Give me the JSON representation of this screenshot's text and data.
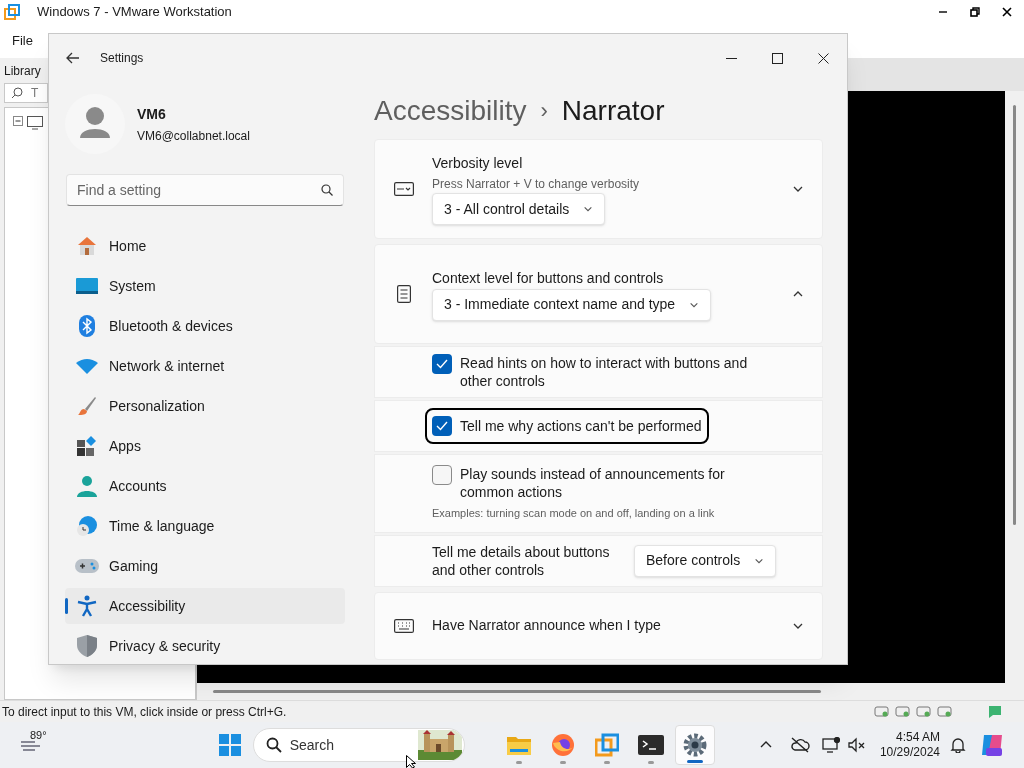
{
  "vmware": {
    "title": "Windows 7 - VMware Workstation",
    "menu": [
      "File"
    ],
    "library": {
      "label": "Library",
      "search_text": "T"
    },
    "status_text": "To direct input to this VM, click inside or press Ctrl+G."
  },
  "settings": {
    "title": "Settings",
    "user": {
      "name": "VM6",
      "email": "VM6@collabnet.local"
    },
    "search": {
      "placeholder": "Find a setting"
    },
    "nav": [
      {
        "label": "Home",
        "selected": false
      },
      {
        "label": "System",
        "selected": false
      },
      {
        "label": "Bluetooth & devices",
        "selected": false
      },
      {
        "label": "Network & internet",
        "selected": false
      },
      {
        "label": "Personalization",
        "selected": false
      },
      {
        "label": "Apps",
        "selected": false
      },
      {
        "label": "Accounts",
        "selected": false
      },
      {
        "label": "Time & language",
        "selected": false
      },
      {
        "label": "Gaming",
        "selected": false
      },
      {
        "label": "Accessibility",
        "selected": true
      },
      {
        "label": "Privacy & security",
        "selected": false
      }
    ],
    "breadcrumb": {
      "parent": "Accessibility",
      "separator": "›",
      "current": "Narrator"
    },
    "cards": [
      {
        "kind": "expander",
        "title": "Verbosity level",
        "subtitle": "Press Narrator + V to change verbosity",
        "dropdown": "3 - All control details",
        "expanded": false
      },
      {
        "kind": "expander",
        "title": "Context level for buttons and controls",
        "dropdown": "3 - Immediate context name and type",
        "expanded": true,
        "children": [
          {
            "kind": "checkbox",
            "label": "Read hints on how to interact with buttons and other controls",
            "checked": true,
            "focused": false
          },
          {
            "kind": "checkbox",
            "label": "Tell me why actions can't be performed",
            "checked": true,
            "focused": true
          },
          {
            "kind": "checkbox",
            "label": "Play sounds instead of announcements for common actions",
            "note": "Examples: turning scan mode on and off, landing on a link",
            "checked": false,
            "focused": false
          },
          {
            "kind": "select",
            "label": "Tell me details about buttons and other controls",
            "value": "Before controls"
          }
        ]
      },
      {
        "kind": "expander",
        "title": "Have Narrator announce when I type",
        "expanded": false
      }
    ]
  },
  "taskbar": {
    "weather": "89°",
    "search": {
      "placeholder": "Search"
    },
    "apps": [
      {
        "selected": false
      },
      {
        "selected": false
      },
      {
        "selected": false
      },
      {
        "selected": false
      },
      {
        "selected": true
      }
    ],
    "time": "4:54 AM",
    "date": "10/29/2024"
  }
}
